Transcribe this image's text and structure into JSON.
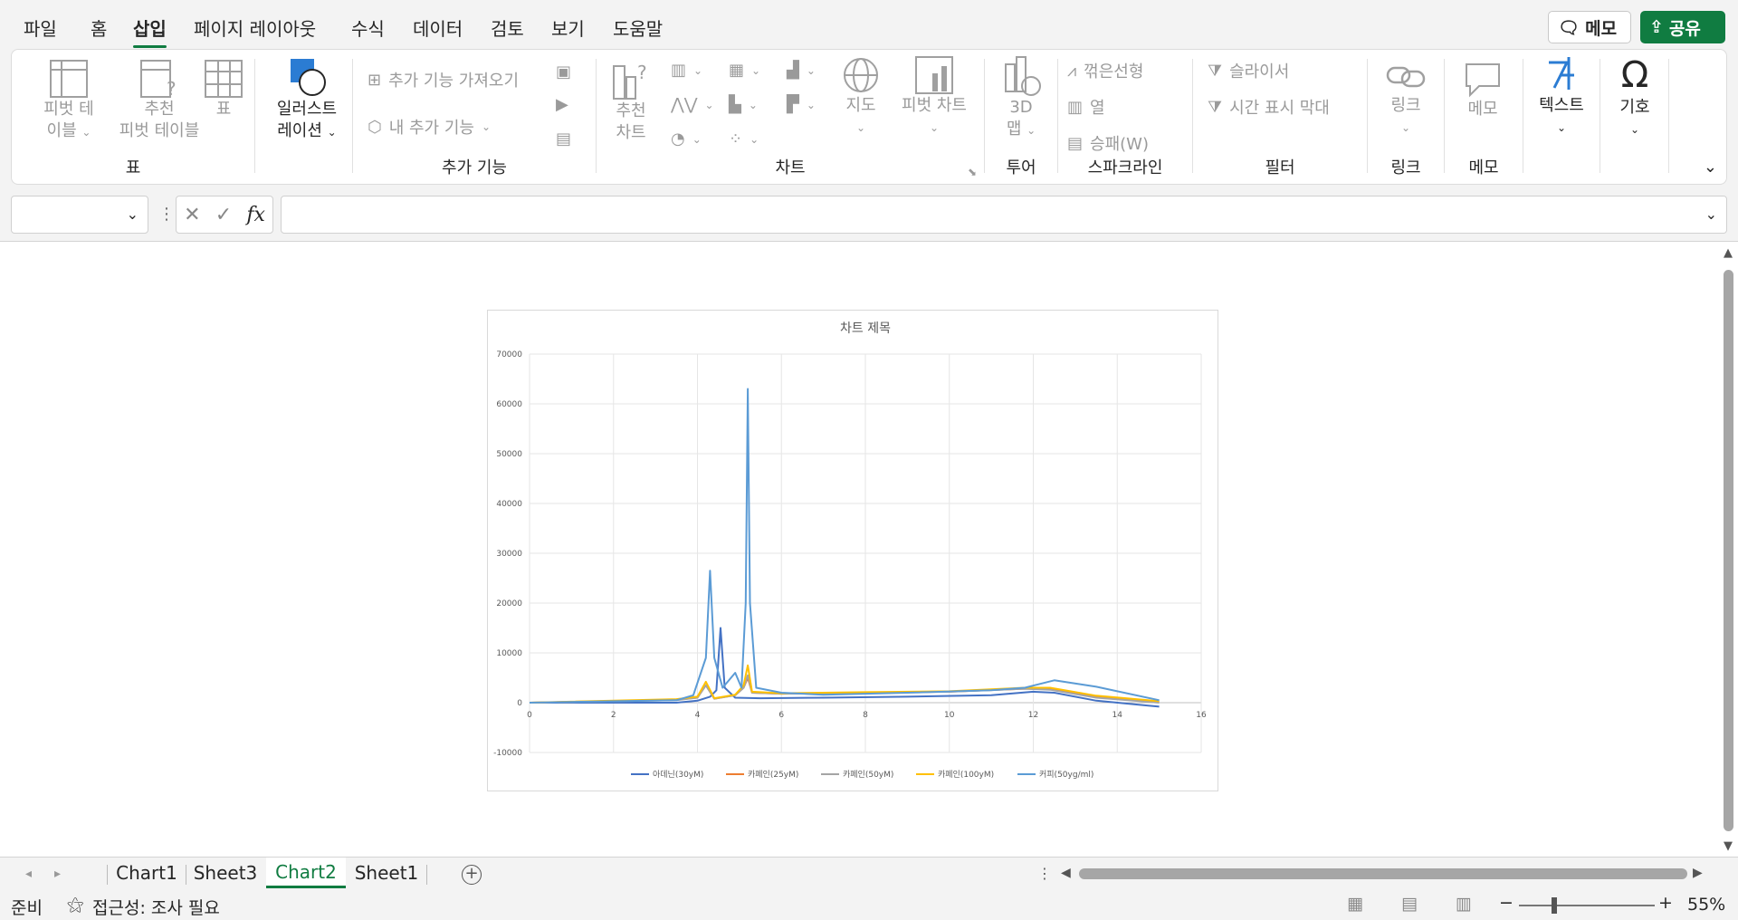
{
  "menu": {
    "items": [
      "파일",
      "홈",
      "삽입",
      "페이지 레이아웃",
      "수식",
      "데이터",
      "검토",
      "보기",
      "도움말"
    ],
    "memo_label": "메모",
    "share_label": "공유"
  },
  "ribbon": {
    "groups": {
      "table": "표",
      "addins": "추가 기능",
      "charts": "차트",
      "tour": "투어",
      "sparklines": "스파크라인",
      "filters": "필터",
      "links": "링크",
      "comments": "메모"
    },
    "pivot_table_1": "피벗 테",
    "pivot_table_2": "이블",
    "rec_pivot_1": "추천",
    "rec_pivot_2": "피벗 테이블",
    "table": "표",
    "illustrations_1": "일러스트",
    "illustrations_2": "레이션",
    "get_addins": "추가 기능 가져오기",
    "my_addins": "내 추가 기능",
    "rec_charts_1": "추천",
    "rec_charts_2": "차트",
    "maps": "지도",
    "pivot_chart": "피벗 차트",
    "map3d_1": "3D",
    "map3d_2": "맵",
    "spark_line": "꺾은선형",
    "spark_column": "열",
    "spark_winloss": "승패(W)",
    "slicer": "슬라이서",
    "timeline": "시간 표시 막대",
    "link": "링크",
    "comment": "메모",
    "text": "텍스트",
    "symbols": "기호"
  },
  "formula_bar": {
    "name_box": "",
    "formula": "",
    "fx": "fx"
  },
  "sheets": {
    "tabs": [
      "Chart1",
      "Sheet3",
      "Chart2",
      "Sheet1"
    ],
    "active": "Chart2"
  },
  "status": {
    "ready": "준비",
    "accessibility": "접근성: 조사 필요",
    "zoom": "55%"
  },
  "chart_data": {
    "type": "line",
    "title": "차트 제목",
    "xlim": [
      0,
      16
    ],
    "ylim": [
      -10000,
      70000
    ],
    "x_ticks": [
      0,
      2,
      4,
      6,
      8,
      10,
      12,
      14,
      16
    ],
    "y_ticks": [
      -10000,
      0,
      10000,
      20000,
      30000,
      40000,
      50000,
      60000,
      70000
    ],
    "grid": true,
    "legend_position": "bottom",
    "series": [
      {
        "name": "아데닌(30yM)",
        "color": "#4472c4",
        "x": [
          0,
          3.5,
          4.0,
          4.3,
          4.45,
          4.55,
          4.65,
          4.9,
          5.5,
          7,
          9,
          11,
          12,
          12.5,
          13.5,
          15
        ],
        "y": [
          0,
          0,
          400,
          1200,
          2500,
          15000,
          3000,
          1000,
          900,
          1000,
          1200,
          1500,
          2200,
          2000,
          400,
          -800
        ]
      },
      {
        "name": "카페인(25yM)",
        "color": "#ed7d31",
        "x": [
          0,
          3.5,
          4.0,
          4.2,
          4.4,
          4.9,
          5.1,
          5.2,
          5.3,
          6,
          8,
          10,
          11.8,
          12.4,
          13.5,
          15
        ],
        "y": [
          0,
          600,
          1000,
          3500,
          800,
          1500,
          3000,
          5000,
          2000,
          1800,
          2000,
          2200,
          2800,
          2800,
          1200,
          200
        ]
      },
      {
        "name": "카페인(50yM)",
        "color": "#a5a5a5",
        "x": [
          0,
          3.5,
          4.0,
          4.2,
          4.4,
          4.9,
          5.1,
          5.2,
          5.3,
          6,
          8,
          10,
          11.8,
          12.4,
          13.5,
          15
        ],
        "y": [
          0,
          500,
          1000,
          3500,
          800,
          1500,
          3000,
          5500,
          2000,
          1800,
          2000,
          2200,
          2800,
          2600,
          1000,
          0
        ]
      },
      {
        "name": "카페인(100yM)",
        "color": "#ffc000",
        "x": [
          0,
          3.5,
          4.0,
          4.2,
          4.4,
          4.9,
          5.1,
          5.2,
          5.3,
          6,
          8,
          10,
          11.8,
          12.4,
          13.5,
          15
        ],
        "y": [
          0,
          700,
          1200,
          4200,
          900,
          1600,
          3500,
          7500,
          2200,
          1900,
          2100,
          2300,
          3000,
          3000,
          1400,
          300
        ]
      },
      {
        "name": "커피(50yg/ml)",
        "color": "#5b9bd5",
        "x": [
          0,
          3.5,
          3.9,
          4.2,
          4.3,
          4.4,
          4.6,
          4.9,
          5.05,
          5.15,
          5.2,
          5.25,
          5.4,
          6,
          7,
          9,
          11,
          11.8,
          12.5,
          13.5,
          15
        ],
        "y": [
          0,
          500,
          1500,
          9000,
          26500,
          9000,
          3000,
          6000,
          3000,
          20000,
          63000,
          20000,
          3000,
          2000,
          1600,
          2000,
          2500,
          3000,
          4500,
          3200,
          500
        ]
      }
    ]
  }
}
